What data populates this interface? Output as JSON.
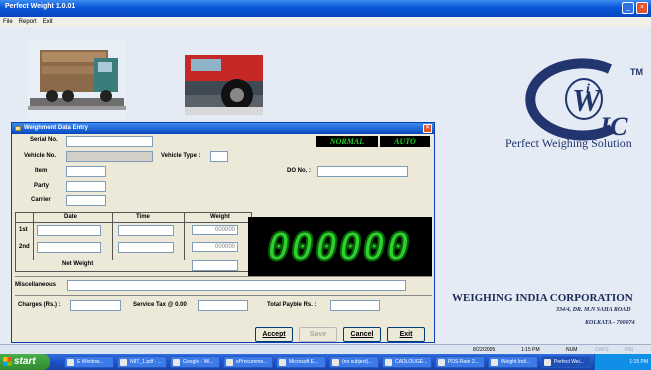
{
  "app": {
    "title": "Perfect Weight 1.0.01"
  },
  "menu": [
    "File",
    "Report",
    "Exit"
  ],
  "logo": {
    "initials": "WIC",
    "tm": "TM",
    "tagline": "Perfect Weighing Solution"
  },
  "company": {
    "name": "WEIGHING INDIA CORPORATION",
    "address1": "334/4, DR. M.N SAHA ROAD",
    "address2": "KOLKATA - 700074"
  },
  "dialog": {
    "title": "Weighment Data Entry",
    "status_mode": "NORMAL",
    "status_auto": "AUTO",
    "labels": {
      "serial_no": "Serial No.",
      "vehicle_no": "Vehicle No.",
      "vehicle_type": "Vehicle Type :",
      "item": "Item",
      "party": "Party",
      "carrier": "Carrier",
      "do_no": "DO No. :",
      "miscellaneous": "Miscellaneous",
      "charges": "Charges (Rs.) :",
      "service_tax": "Service Tax @ 0.00",
      "total_payable": "Total Payble Rs. :"
    },
    "grid": {
      "headers": [
        "Date",
        "Time",
        "Weight"
      ],
      "rows": [
        {
          "label": "1st",
          "weight": "000000"
        },
        {
          "label": "2nd",
          "weight": "000000"
        }
      ],
      "net_weight_label": "Net Weight"
    },
    "display_value": "000000",
    "buttons": {
      "accept": "Accept",
      "save": "Save",
      "cancel": "Cancel",
      "exit": "Exit"
    }
  },
  "statusbar": {
    "date": "8/22/2005",
    "time": "1:15 PM",
    "num": "NUM",
    "caps": "CAPS",
    "ins": "INS"
  },
  "taskbar": {
    "start": "start",
    "tasks": [
      "E Window...",
      "NIIT_1.pdf - ...",
      "Google - Wi...",
      "eProcureme...",
      "Microsoft E...",
      "(no subject)...",
      "CADLOUGE...",
      "PDS-Rate 2...",
      "Weight Indi...",
      "Perfect Wei..."
    ],
    "clock": "1:15 PM"
  }
}
